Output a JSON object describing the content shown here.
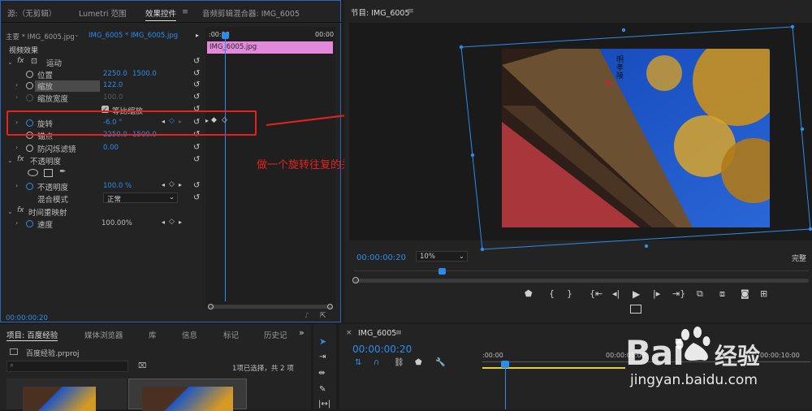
{
  "top_tabs": {
    "source": "源:（无剪辑）",
    "lumetri": "Lumetri 范围",
    "effect_controls": "效果控件",
    "menu_glyph": "≡",
    "audio_mixer": "音频剪辑混合器: IMG_6005"
  },
  "ec": {
    "master": "主要 * IMG_6005.jpg",
    "clip": "IMG_6005 * IMG_6005.jpg",
    "time_start": ":00:00",
    "time_end": "00:00",
    "clip_bar": "IMG_6005.jpg",
    "section": "视频效果",
    "motion": "运动",
    "position": "位置",
    "pos_x": "2250.0",
    "pos_y": "1500.0",
    "scale": "缩放",
    "scale_v": "122.0",
    "scale_w": "缩放宽度",
    "scale_w_v": "100.0",
    "uniform": "等比缩放",
    "rotation": "旋转",
    "rotation_v": "-6.0 °",
    "anchor": "锚点",
    "anc_x": "2250.0",
    "anc_y": "1500.0",
    "antiflicker": "防闪烁滤镜",
    "antiflicker_v": "0.00",
    "opacity_group": "不透明度",
    "opacity": "不透明度",
    "opacity_v": "100.0 %",
    "blend": "混合模式",
    "blend_v": "正常",
    "timeremap": "时间重映射",
    "speed": "速度",
    "speed_v": "100.00%",
    "timecode": "00:00:00:20"
  },
  "annotation": "做一个旋转往复的关键帧动画",
  "program": {
    "title": "节目: IMG_6005",
    "menu": "≡",
    "timecode": "00:00:00:20",
    "zoom": "10%",
    "quality": "完整",
    "image_text": "明孝陵"
  },
  "project": {
    "tabs": [
      "项目: 百度经验",
      "媒体浏览器",
      "库",
      "信息",
      "标记",
      "历史记"
    ],
    "more": "»",
    "file": "百度经验.prproj",
    "search_placeholder": "",
    "status": "1项已选择，共 2 项"
  },
  "timeline": {
    "close": "×",
    "name": "IMG_6005",
    "menu": "≡",
    "timecode": "00:00:00:20",
    "ruler_0": ":00:00",
    "ruler_1": "00:00:05:00",
    "ruler_2": "00:00:10:00"
  },
  "watermark": {
    "brand": "Bai",
    "brand2": "经验",
    "url": "jingyan.baidu.com"
  },
  "colors": {
    "accent": "#2d8ceb",
    "clip": "#e389dc",
    "red_box": "#e5231e"
  }
}
